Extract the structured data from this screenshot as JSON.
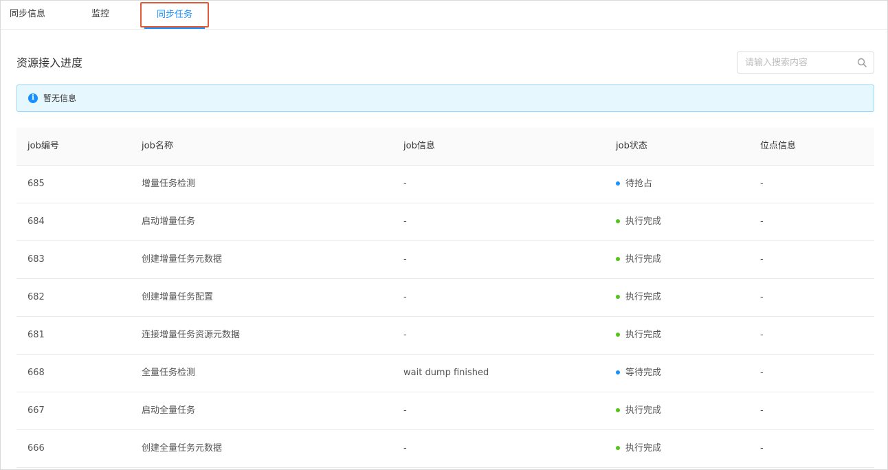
{
  "tabs": [
    {
      "label": "同步信息"
    },
    {
      "label": "监控"
    },
    {
      "label": "同步任务"
    }
  ],
  "section": {
    "title": "资源接入进度"
  },
  "search": {
    "placeholder": "请输入搜索内容",
    "icon": "search-icon"
  },
  "alert": {
    "icon": "info-icon",
    "text": "暂无信息"
  },
  "table": {
    "headers": [
      "job编号",
      "job名称",
      "job信息",
      "job状态",
      "位点信息"
    ],
    "rows": [
      {
        "id": "685",
        "name": "增量任务检测",
        "info": "-",
        "status": "待抢占",
        "status_color": "#1890ff",
        "position": "-"
      },
      {
        "id": "684",
        "name": "启动增量任务",
        "info": "-",
        "status": "执行完成",
        "status_color": "#52c41a",
        "position": "-"
      },
      {
        "id": "683",
        "name": "创建增量任务元数据",
        "info": "-",
        "status": "执行完成",
        "status_color": "#52c41a",
        "position": "-"
      },
      {
        "id": "682",
        "name": "创建增量任务配置",
        "info": "-",
        "status": "执行完成",
        "status_color": "#52c41a",
        "position": "-"
      },
      {
        "id": "681",
        "name": "连接增量任务资源元数据",
        "info": "-",
        "status": "执行完成",
        "status_color": "#52c41a",
        "position": "-"
      },
      {
        "id": "668",
        "name": "全量任务检测",
        "info": "wait dump finished",
        "status": "等待完成",
        "status_color": "#1890ff",
        "position": "-"
      },
      {
        "id": "667",
        "name": "启动全量任务",
        "info": "-",
        "status": "执行完成",
        "status_color": "#52c41a",
        "position": "-"
      },
      {
        "id": "666",
        "name": "创建全量任务元数据",
        "info": "-",
        "status": "执行完成",
        "status_color": "#52c41a",
        "position": "-"
      }
    ]
  },
  "colors": {
    "accent": "#1890ff",
    "success": "#52c41a",
    "active_tab_outline": "#e05a3a"
  }
}
